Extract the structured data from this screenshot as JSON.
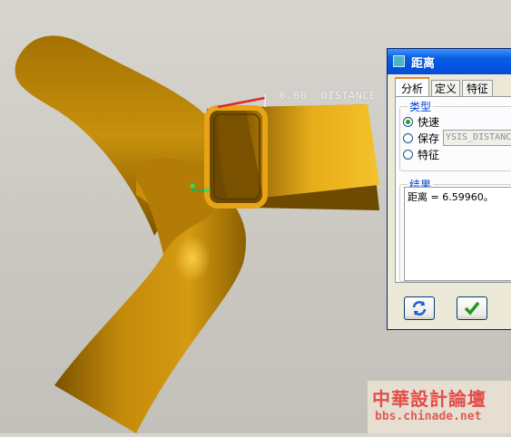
{
  "viewport": {
    "dimension_label": "6.60  DISTANCE"
  },
  "dialog": {
    "title": "距离",
    "tabs": [
      {
        "label": "分析"
      },
      {
        "label": "定义"
      },
      {
        "label": "特征"
      }
    ],
    "type_group": {
      "label": "类型",
      "options": [
        {
          "label": "快速",
          "checked": true
        },
        {
          "label": "保存",
          "checked": false
        },
        {
          "label": "特征",
          "checked": false
        }
      ],
      "name_value": "YSIS_DISTANCE"
    },
    "result_group": {
      "label": "结果",
      "text": "距离 = 6.59960。"
    },
    "buttons": {
      "repeat_icon": "refresh-icon",
      "ok_icon": "checkmark-icon"
    }
  },
  "watermark": {
    "name": "中華設計論壇",
    "url": "bbs.chinade.net"
  },
  "colors": {
    "part": "#c58a08",
    "selection": "#e0242c",
    "title_bar": "#0054e3"
  }
}
